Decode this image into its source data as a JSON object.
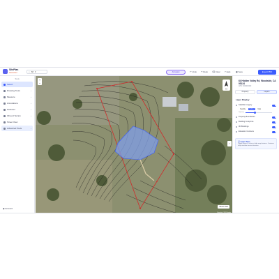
{
  "app": {
    "logo_line1": "SitePlan",
    "logo_line2": "Generator"
  },
  "topbar": {
    "search_icon": "search-icon",
    "zoom_value": "88",
    "ai_button": "AI Assist",
    "undo": "Undo",
    "redo": "Redo",
    "clear": "Clear",
    "help": "Help",
    "save": "Save",
    "export": "Export PDF"
  },
  "sidebar": {
    "header": "Tools",
    "items": [
      {
        "label": "Select"
      },
      {
        "label": "Drawing Tools"
      },
      {
        "label": "Measure"
      },
      {
        "label": "Annotations"
      },
      {
        "label": "Features"
      },
      {
        "label": "3D and Terrain"
      },
      {
        "label": "Street View"
      },
      {
        "label": "Advanced Tools"
      }
    ],
    "account": "Account"
  },
  "map": {
    "zoom_in": "+",
    "zoom_out": "−",
    "street_view": "Street View",
    "attribution": "Map data ©2024 Google"
  },
  "panel": {
    "address": "64 Hidden Valley Rd, Woodside, CA 95134",
    "apn": "APN: 000000000",
    "tab_property": "Property",
    "tab_layers": "Layers",
    "layer_display": "Layer Display",
    "layers": [
      {
        "label": "Satellite Imagery"
      },
      {
        "label": "Property Boundaries"
      },
      {
        "label": "Building Footprints"
      },
      {
        "label": "3D Buildings"
      },
      {
        "label": "Elevation Contours"
      }
    ],
    "imagery_options": [
      "Satellite",
      "Hybrid",
      "Map"
    ],
    "imagery_selected": 1,
    "opacity_label": "Opacity",
    "opacity_value": 0.35,
    "tips_title": "Layer Tips",
    "tips_text": "Toggle layers to show or hide map features. Contours help visualize terrain elevation."
  }
}
